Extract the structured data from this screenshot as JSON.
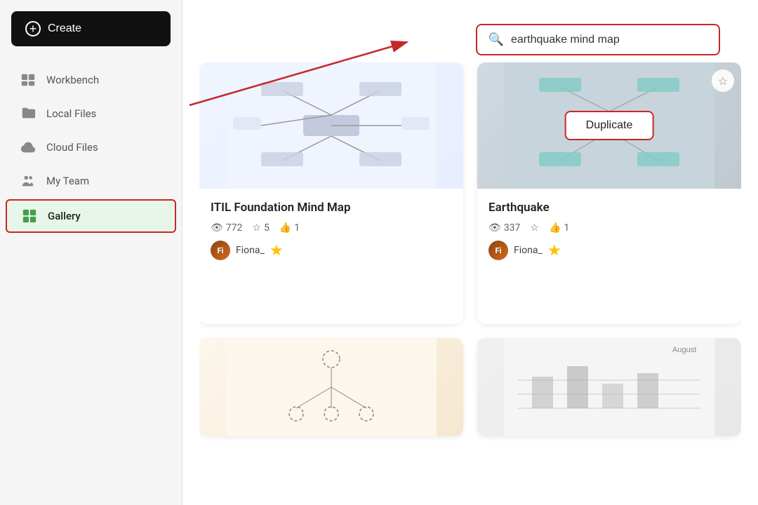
{
  "sidebar": {
    "create_label": "Create",
    "items": [
      {
        "id": "workbench",
        "label": "Workbench",
        "icon": "workbench-icon",
        "active": false
      },
      {
        "id": "local-files",
        "label": "Local Files",
        "icon": "folder-icon",
        "active": false
      },
      {
        "id": "cloud-files",
        "label": "Cloud Files",
        "icon": "cloud-icon",
        "active": false
      },
      {
        "id": "my-team",
        "label": "My Team",
        "icon": "team-icon",
        "active": false
      },
      {
        "id": "gallery",
        "label": "Gallery",
        "icon": "gallery-icon",
        "active": true
      }
    ]
  },
  "search": {
    "placeholder": "earthquake mind map",
    "value": "earthquake mind map"
  },
  "cards": [
    {
      "id": "itil",
      "title": "ITIL Foundation Mind Map",
      "views": "772",
      "stars": "5",
      "likes": "1",
      "author": "Fiona_",
      "thumbnail_type": "itil"
    },
    {
      "id": "earthquake",
      "title": "Earthquake",
      "views": "337",
      "stars": "",
      "likes": "1",
      "author": "Fiona_",
      "thumbnail_type": "earthquake",
      "show_duplicate": true
    },
    {
      "id": "third",
      "title": "",
      "views": "",
      "stars": "",
      "likes": "",
      "author": "",
      "thumbnail_type": "third"
    },
    {
      "id": "fourth",
      "title": "",
      "views": "",
      "stars": "",
      "likes": "",
      "author": "",
      "thumbnail_type": "fourth"
    }
  ],
  "labels": {
    "duplicate": "Duplicate",
    "views_icon": "👁",
    "star_icon": "☆",
    "like_icon": "👍",
    "star_filled": "★"
  },
  "colors": {
    "active_nav_border": "#c62828",
    "search_border": "#c62828",
    "gallery_green": "#43a047"
  }
}
